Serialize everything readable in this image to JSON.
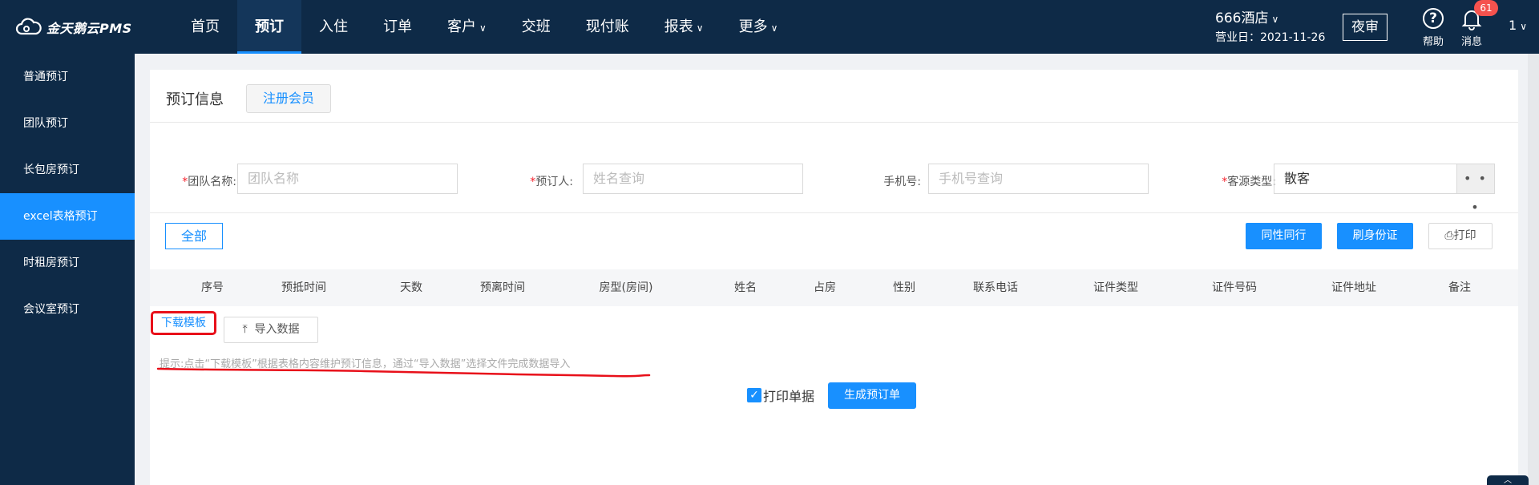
{
  "app": {
    "logo_text": "金天鹅云PMS"
  },
  "nav": {
    "items": [
      {
        "label": "首页",
        "has_dropdown": false
      },
      {
        "label": "预订",
        "has_dropdown": false,
        "active": true
      },
      {
        "label": "入住",
        "has_dropdown": false
      },
      {
        "label": "订单",
        "has_dropdown": false
      },
      {
        "label": "客户",
        "has_dropdown": true
      },
      {
        "label": "交班",
        "has_dropdown": false
      },
      {
        "label": "现付账",
        "has_dropdown": false
      },
      {
        "label": "报表",
        "has_dropdown": true
      },
      {
        "label": "更多",
        "has_dropdown": true
      }
    ]
  },
  "header": {
    "hotel_name": "666酒店",
    "business_date": "营业日：2021-11-26",
    "night_audit": "夜审",
    "help_label": "帮助",
    "message_label": "消息",
    "message_count": "61",
    "user": "1"
  },
  "sidebar": {
    "items": [
      {
        "label": "普通预订"
      },
      {
        "label": "团队预订"
      },
      {
        "label": "长包房预订"
      },
      {
        "label": "excel表格预订",
        "active": true
      },
      {
        "label": "时租房预订"
      },
      {
        "label": "会议室预订"
      }
    ]
  },
  "section": {
    "title": "预订信息",
    "register_button": "注册会员"
  },
  "form": {
    "team_name": {
      "label": "团队名称:",
      "placeholder": "团队名称",
      "required": true
    },
    "booker": {
      "label": "预订人:",
      "placeholder": "姓名查询",
      "required": true
    },
    "phone": {
      "label": "手机号:",
      "placeholder": "手机号查询",
      "required": false
    },
    "source_type": {
      "label": "客源类型:",
      "value": "散客",
      "required": true,
      "more": "• • •"
    }
  },
  "toolbar": {
    "all_button": "全部",
    "same_travel_button": "同性同行",
    "swipe_id_button": "刷身份证",
    "print_button": "打印"
  },
  "table": {
    "columns": [
      "序号",
      "预抵时间",
      "天数",
      "预离时间",
      "房型(房间)",
      "姓名",
      "占房",
      "性别",
      "联系电话",
      "证件类型",
      "证件号码",
      "证件地址",
      "备注"
    ]
  },
  "import": {
    "download_template": "下载模板",
    "import_data": "导入数据",
    "hint": "提示:点击“下载模板”根据表格内容维护预订信息，通过“导入数据”选择文件完成数据导入"
  },
  "footer": {
    "print_receipt_label": "打印单据",
    "print_receipt_checked": true,
    "generate_button": "生成预订单"
  },
  "colors": {
    "nav_bg": "#0e2a47",
    "accent": "#1890ff",
    "required": "#f5222d",
    "annotation_red": "#e8101a",
    "badge": "#f5524e"
  }
}
